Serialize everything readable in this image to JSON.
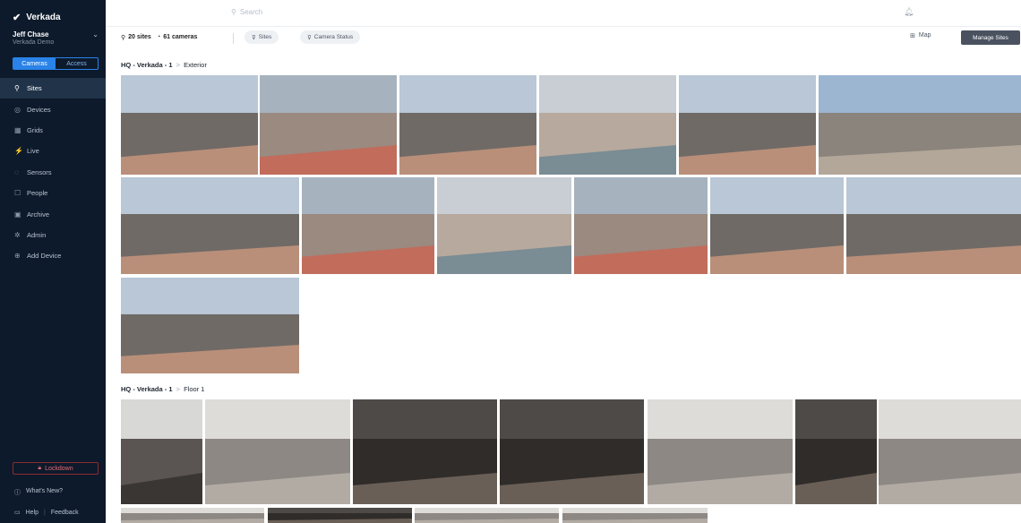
{
  "sidebar": {
    "brand": "Verkada",
    "user_name": "Jeff Chase",
    "user_org": "Verkada Demo",
    "toggle": {
      "left": "Cameras",
      "right": "Access"
    },
    "nav": [
      {
        "label": "Sites",
        "icon": "pin-icon",
        "glyph": "⚲",
        "active": true
      },
      {
        "label": "Devices",
        "icon": "device-icon",
        "glyph": "◎"
      },
      {
        "label": "Grids",
        "icon": "grid-icon",
        "glyph": "▦"
      },
      {
        "label": "Live",
        "icon": "live-icon",
        "glyph": "⚡"
      },
      {
        "label": "Sensors",
        "icon": "sensor-icon",
        "glyph": "◌"
      },
      {
        "label": "People",
        "icon": "people-icon",
        "glyph": "☐"
      },
      {
        "label": "Archive",
        "icon": "archive-icon",
        "glyph": "▣"
      },
      {
        "label": "Admin",
        "icon": "gear-icon",
        "glyph": "✲"
      },
      {
        "label": "Add Device",
        "icon": "add-icon",
        "glyph": "⊕"
      }
    ],
    "lockdown": "Lockdown",
    "whats_new": "What's New?",
    "help": "Help",
    "feedback": "Feedback"
  },
  "topbar": {
    "search_placeholder": "Search"
  },
  "filters": {
    "sites_count": "20 sites",
    "cameras_count": "61 cameras",
    "chip_sites": "Sites",
    "chip_status": "Camera Status",
    "map": "Map",
    "manage": "Manage Sites"
  },
  "sections": [
    {
      "site": "HQ - Verkada - 1",
      "sep": ">",
      "area": "Exterior"
    },
    {
      "site": "HQ - Verkada - 1",
      "sep": ">",
      "area": "Floor 1"
    }
  ],
  "colors": {
    "sidebar": "#0d1a2b",
    "accent": "#2a83e8",
    "lockdown": "#e06c78"
  }
}
